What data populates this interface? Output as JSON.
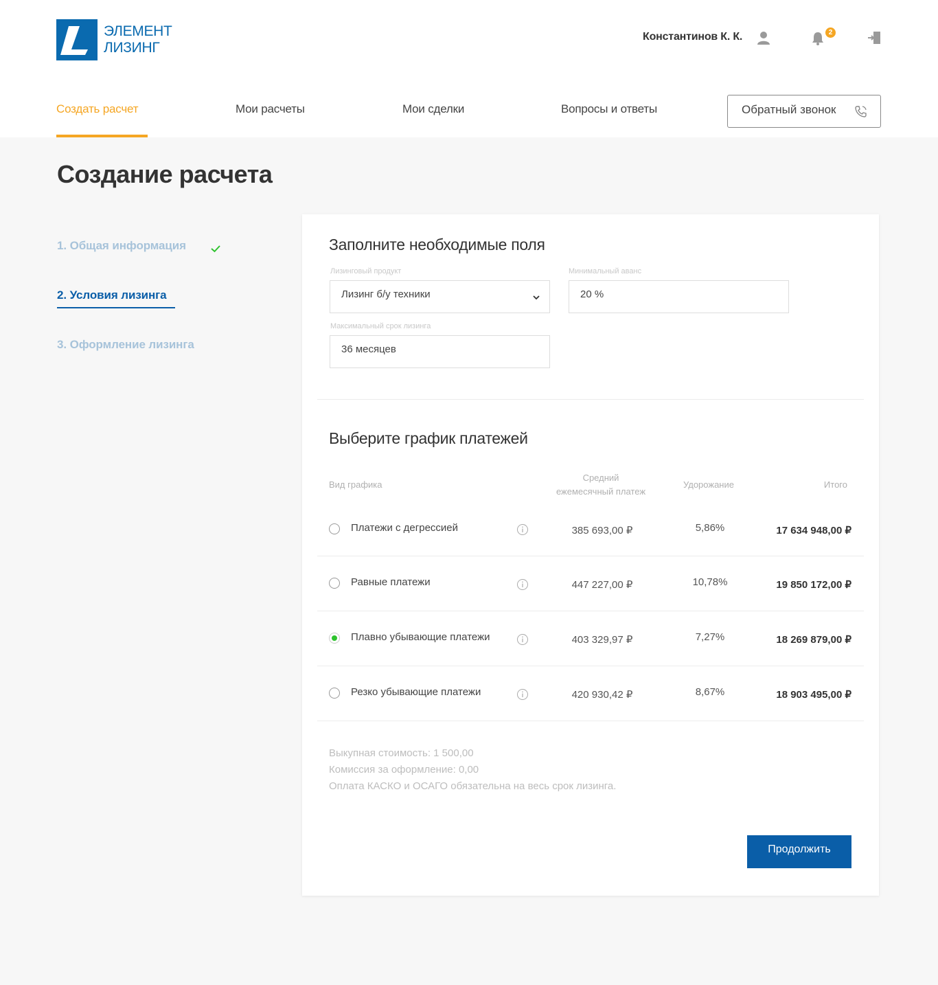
{
  "brand": {
    "line1": "ЭЛЕМЕНТ",
    "line2": "ЛИЗИНГ",
    "color": "#0a6aaf"
  },
  "header": {
    "user_name": "Константинов К. К.",
    "notifications_count": "2",
    "icons": [
      "user-icon",
      "bell-icon",
      "logout-icon"
    ]
  },
  "nav": {
    "items": [
      {
        "label": "Создать расчет",
        "active": true
      },
      {
        "label": "Мои расчеты"
      },
      {
        "label": "Мои сделки"
      },
      {
        "label": "Вопросы и ответы"
      }
    ],
    "callback_label": "Обратный звонок",
    "accent": "#f5a623"
  },
  "page": {
    "title": "Создание расчета"
  },
  "steps": [
    {
      "label": "1. Общая информация",
      "state": "done"
    },
    {
      "label": "2. Условия лизинга",
      "state": "current"
    },
    {
      "label": "3. Оформление лизинга",
      "state": "next"
    }
  ],
  "form": {
    "title": "Заполните необходимые поля",
    "product": {
      "label": "Лизинговый продукт",
      "value": "Лизинг б/у техники"
    },
    "advance": {
      "label": "Минимальный аванс",
      "value": "20 %"
    },
    "term": {
      "label": "Максимальный срок лизинга",
      "value": "36 месяцев"
    }
  },
  "schedule": {
    "title": "Выберите график платежей",
    "headers": {
      "type": "Вид графика",
      "monthly_line1": "Средний",
      "monthly_line2": "ежемесячный платеж",
      "increase": "Удорожание",
      "total": "Итого"
    },
    "rows": [
      {
        "name": "Платежи с дегрессией",
        "monthly": "385 693,00 ₽",
        "increase": "5,86%",
        "total": "17 634 948,00 ₽",
        "selected": false
      },
      {
        "name": "Равные платежи",
        "monthly": "447 227,00 ₽",
        "increase": "10,78%",
        "total": "19 850 172,00 ₽",
        "selected": false
      },
      {
        "name": "Плавно убывающие платежи",
        "monthly": "403 329,97 ₽",
        "increase": "7,27%",
        "total": "18 269 879,00 ₽",
        "selected": true
      },
      {
        "name": "Резко убывающие платежи",
        "monthly": "420 930,42 ₽",
        "increase": "8,67%",
        "total": "18 903 495,00 ₽",
        "selected": false
      }
    ]
  },
  "notes": [
    "Выкупная стоимость: 1 500,00",
    "Комиссия за оформление: 0,00",
    "Оплата КАСКО и ОСАГО обязательна на весь срок лизинга."
  ],
  "actions": {
    "continue_label": "Продолжить",
    "primary_color": "#0a5ea8"
  }
}
